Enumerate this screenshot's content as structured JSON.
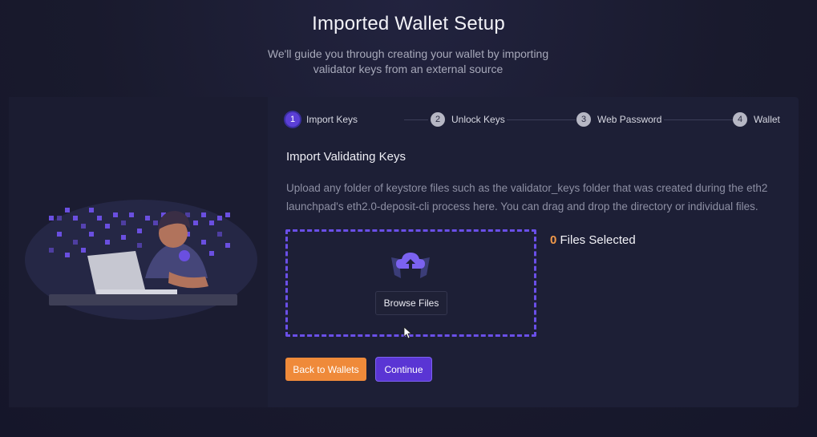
{
  "header": {
    "title": "Imported Wallet Setup",
    "subtitle": "We'll guide you through creating your wallet by importing validator keys from an external source"
  },
  "steps": [
    {
      "number": "1",
      "label": "Import Keys",
      "active": true
    },
    {
      "number": "2",
      "label": "Unlock Keys",
      "active": false
    },
    {
      "number": "3",
      "label": "Web Password",
      "active": false
    },
    {
      "number": "4",
      "label": "Wallet",
      "active": false
    }
  ],
  "main": {
    "heading": "Import Validating Keys",
    "description": "Upload any folder of keystore files such as the validator_keys folder that was created during the eth2 launchpad's eth2.0-deposit-cli process here. You can drag and drop the directory or individual files.",
    "dropzone": {
      "browse_label": "Browse Files",
      "icon": "cloud-upload-icon"
    },
    "files_count": "0",
    "files_label": "Files Selected"
  },
  "actions": {
    "back_label": "Back to Wallets",
    "continue_label": "Continue"
  },
  "colors": {
    "accent": "#5a35d4",
    "orange": "#ef8a3a",
    "dashed_border": "#6a4fe8",
    "background": "#191a2d"
  }
}
